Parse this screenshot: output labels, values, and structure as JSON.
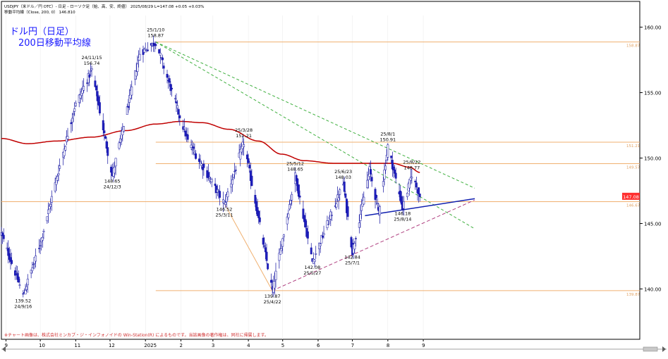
{
  "header": {
    "line1": "USDJPY（米ドル／円 OTC）- 日足 - ローソク足（始、高、安、終値） 2025/08/29 L=147.08 +0.05 +0.03%",
    "line2": "移動平均線（Close, 200, 0） 146.810"
  },
  "overlay": {
    "title_line1": "ドル円（日足）",
    "title_line2": "200日移動平均線"
  },
  "footer": {
    "note": "※チャート画像は、株式会社ミンカブ・ジ・インフォノイドの Win-Station(R) によるものです。当該画像の著作権は、同社に帰属します。"
  },
  "colors": {
    "up": "#ffffff",
    "down": "#2020c0",
    "ma": "#c00000",
    "hline": "#f0b070",
    "green_dash": "#40b040",
    "purple_dash": "#b04080",
    "blue_line": "#1020b0",
    "price_tag": "#ff3030"
  },
  "chart_data": {
    "type": "candlestick",
    "title": "ドル円（日足） 200日移動平均線",
    "ylim": [
      137.5,
      161
    ],
    "yticks": [
      140,
      145,
      150,
      155,
      160
    ],
    "ytick_labels": [
      "140.00",
      "145.00",
      "150.00",
      "155.00",
      "160.00"
    ],
    "xtick_labels": [
      "9",
      "10",
      "11",
      "12",
      "2025",
      "2",
      "3",
      "4",
      "5",
      "6",
      "7",
      "8",
      "9"
    ],
    "last_price_label": "147.08",
    "horizontal_line_labels": [
      "158.87",
      "151.21",
      "149.57",
      "146.67",
      "139.87"
    ],
    "annotations": [
      {
        "date": "24/9/16",
        "value": "139.52",
        "position": "below"
      },
      {
        "date": "24/11/15",
        "value": "156.74",
        "position": "above"
      },
      {
        "date": "24/12/3",
        "value": "148.65",
        "position": "below"
      },
      {
        "date": "25/1/10",
        "value": "158.87",
        "position": "above"
      },
      {
        "date": "25/3/11",
        "value": "146.52",
        "position": "below"
      },
      {
        "date": "25/3/28",
        "value": "151.21",
        "position": "above"
      },
      {
        "date": "25/4/22",
        "value": "139.87",
        "position": "below"
      },
      {
        "date": "25/5/12",
        "value": "148.65",
        "position": "above"
      },
      {
        "date": "25/5/27",
        "value": "142.08",
        "position": "below"
      },
      {
        "date": "25/6/23",
        "value": "148.03",
        "position": "above"
      },
      {
        "date": "25/7/1",
        "value": "142.84",
        "position": "below"
      },
      {
        "date": "25/8/1",
        "value": "150.91",
        "position": "above"
      },
      {
        "date": "25/8/14",
        "value": "146.18",
        "position": "below"
      },
      {
        "date": "25/8/22",
        "value": "148.77",
        "position": "above"
      }
    ],
    "pivots": [
      {
        "date": "2024-08-28",
        "price": 144.2
      },
      {
        "date": "2024-09-16",
        "price": 139.52
      },
      {
        "date": "2024-10-01",
        "price": 143.5
      },
      {
        "date": "2024-10-31",
        "price": 153.9
      },
      {
        "date": "2024-11-15",
        "price": 156.74
      },
      {
        "date": "2024-12-03",
        "price": 148.65
      },
      {
        "date": "2024-12-27",
        "price": 158.0
      },
      {
        "date": "2025-01-10",
        "price": 158.87
      },
      {
        "date": "2025-02-07",
        "price": 151.3
      },
      {
        "date": "2025-03-11",
        "price": 146.52
      },
      {
        "date": "2025-03-28",
        "price": 151.21
      },
      {
        "date": "2025-04-22",
        "price": 139.87
      },
      {
        "date": "2025-05-12",
        "price": 148.65
      },
      {
        "date": "2025-05-27",
        "price": 142.08
      },
      {
        "date": "2025-06-23",
        "price": 148.03
      },
      {
        "date": "2025-07-01",
        "price": 142.84
      },
      {
        "date": "2025-07-16",
        "price": 149.1
      },
      {
        "date": "2025-07-24",
        "price": 145.9
      },
      {
        "date": "2025-08-01",
        "price": 150.91
      },
      {
        "date": "2025-08-14",
        "price": 146.18
      },
      {
        "date": "2025-08-22",
        "price": 148.77
      },
      {
        "date": "2025-08-29",
        "price": 147.08
      }
    ],
    "moving_average": {
      "name": "移動平均線（Close, 200, 0）",
      "points": [
        {
          "date": "2024-08-28",
          "value": 151.5
        },
        {
          "date": "2024-09-20",
          "value": 151.1
        },
        {
          "date": "2024-10-15",
          "value": 151.3
        },
        {
          "date": "2024-11-15",
          "value": 151.6
        },
        {
          "date": "2024-12-15",
          "value": 152.1
        },
        {
          "date": "2025-01-10",
          "value": 152.6
        },
        {
          "date": "2025-02-01",
          "value": 152.8
        },
        {
          "date": "2025-02-20",
          "value": 152.7
        },
        {
          "date": "2025-03-15",
          "value": 152.2
        },
        {
          "date": "2025-04-10",
          "value": 151.3
        },
        {
          "date": "2025-04-30",
          "value": 150.3
        },
        {
          "date": "2025-05-20",
          "value": 149.8
        },
        {
          "date": "2025-06-15",
          "value": 149.6
        },
        {
          "date": "2025-07-15",
          "value": 149.6
        },
        {
          "date": "2025-08-05",
          "value": 149.6
        },
        {
          "date": "2025-08-20",
          "value": 149.3
        },
        {
          "date": "2025-08-29",
          "value": 148.9
        }
      ]
    },
    "horizontal_lines": [
      {
        "price": 158.87,
        "from": "2025-01-10"
      },
      {
        "price": 151.21,
        "from": "2025-01-10"
      },
      {
        "price": 149.57,
        "from": "2025-01-10"
      },
      {
        "price": 146.67,
        "from": "2024-08-28"
      },
      {
        "price": 139.87,
        "from": "2025-01-10"
      }
    ],
    "trend_lines": [
      {
        "style": "green_dash",
        "from": {
          "date": "2025-01-10",
          "price": 158.87
        },
        "to": {
          "date": "2025-10-16",
          "price": 147.7
        }
      },
      {
        "style": "green_dash",
        "from": {
          "date": "2025-01-10",
          "price": 158.87
        },
        "to": {
          "date": "2025-10-16",
          "price": 144.6
        }
      },
      {
        "style": "purple_dash",
        "from": {
          "date": "2025-04-22",
          "price": 139.87
        },
        "to": {
          "date": "2025-10-16",
          "price": 146.8
        }
      },
      {
        "style": "blue_line",
        "from": {
          "date": "2025-07-12",
          "price": 145.6
        },
        "to": {
          "date": "2025-10-16",
          "price": 146.9
        }
      },
      {
        "style": "orange_solid",
        "from": {
          "date": "2025-03-11",
          "price": 146.52
        },
        "to": {
          "date": "2025-04-22",
          "price": 139.87
        }
      }
    ]
  }
}
